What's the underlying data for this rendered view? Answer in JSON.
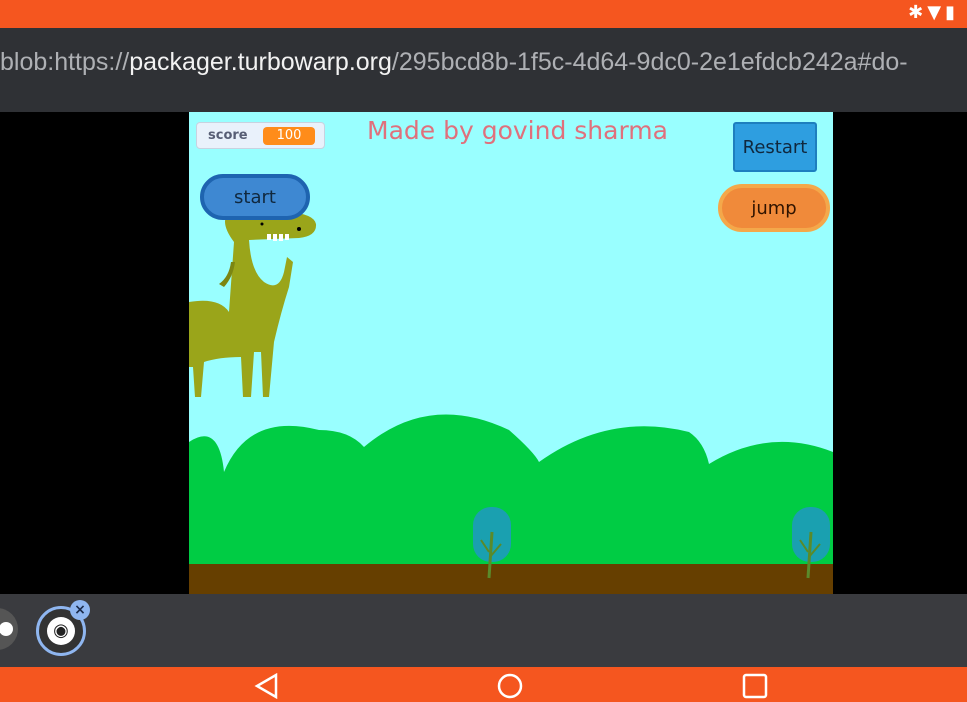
{
  "status_bar": {
    "icons": [
      "bluetooth-icon",
      "wifi-icon",
      "signal-icon"
    ],
    "color": "#f5561f"
  },
  "url_bar": {
    "prefix": "blob:https://",
    "host": "packager.turbowarp.org",
    "path": "/295bcd8b-1f5c-4d64-9dc0-2e1efdcb242a#do-"
  },
  "stage": {
    "score_label": "score",
    "score_value": "100",
    "credit": "Made  by govind sharma",
    "start_label": "start",
    "restart_label": "Restart",
    "jump_label": "jump",
    "sky_color": "#99ffff",
    "hill_color": "#00cc44",
    "ground_color": "#663f00",
    "dino_color": "#9aa51a"
  },
  "tab_bar": {
    "tabs": [
      {
        "icon": "tab-icon"
      },
      {
        "icon": "globe-icon",
        "active": true,
        "close": "×"
      }
    ]
  },
  "nav_bar": {
    "buttons": [
      "back-icon",
      "home-icon",
      "recents-icon"
    ]
  }
}
